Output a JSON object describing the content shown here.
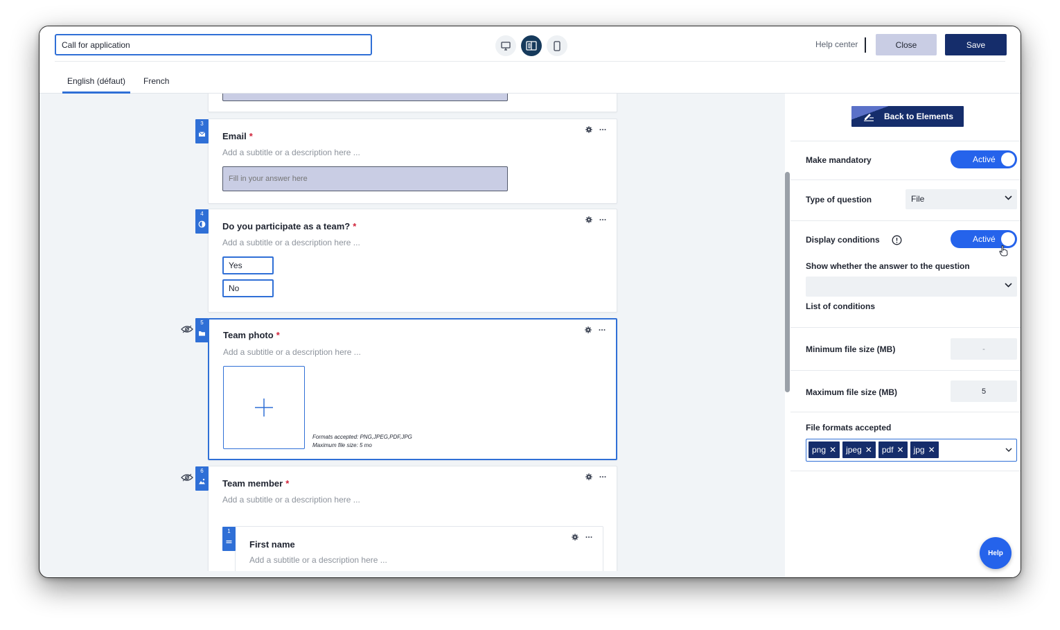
{
  "header": {
    "title_value": "Call for application",
    "help_center": "Help center",
    "close_label": "Close",
    "save_label": "Save",
    "view_modes": [
      "desktop-icon",
      "split-view-icon",
      "mobile-icon"
    ],
    "active_view": "split-view-icon"
  },
  "languages": [
    {
      "label": "English (défaut)",
      "active": true
    },
    {
      "label": "French",
      "active": false
    }
  ],
  "questions": {
    "email": {
      "number": "3",
      "title": "Email",
      "required_mark": "*",
      "subtitle": "Add a subtitle or a description here ...",
      "placeholder": "Fill in your answer here",
      "icon": "envelope-icon"
    },
    "team": {
      "number": "4",
      "title": "Do you participate as a team?",
      "required_mark": "*",
      "subtitle": "Add a subtitle or a description here ...",
      "options": [
        "Yes",
        "No"
      ],
      "icon": "half-circle-icon"
    },
    "photo": {
      "number": "5",
      "title": "Team photo",
      "required_mark": "*",
      "subtitle": "Add a subtitle or a description here ...",
      "formats_line": "Formats accepted: PNG,JPEG,PDF,JPG",
      "size_line": "Maximum file size: 5 mo",
      "icon": "folder-icon"
    },
    "member": {
      "number": "6",
      "title": "Team member",
      "required_mark": "*",
      "subtitle": "Add a subtitle or a description here ...",
      "icon": "image-icon",
      "sub": {
        "number": "1",
        "title": "First name",
        "subtitle": "Add a subtitle or a description here ...",
        "icon": "short-text-icon"
      }
    }
  },
  "panel": {
    "back_label": "Back to Elements",
    "make_mandatory": {
      "label": "Make mandatory",
      "toggle": "Activé"
    },
    "type_of_question": {
      "label": "Type of question",
      "value": "File"
    },
    "display_conditions": {
      "label": "Display conditions",
      "toggle": "Activé",
      "show_label": "Show whether the answer to the question",
      "select_value": "",
      "list_label": "List of conditions"
    },
    "min_size": {
      "label": "Minimum file size (MB)",
      "value": "-"
    },
    "max_size": {
      "label": "Maximum file size (MB)",
      "value": "5"
    },
    "formats": {
      "label": "File formats accepted",
      "tags": [
        "png",
        "jpeg",
        "pdf",
        "jpg"
      ],
      "remove_glyph": "✕"
    }
  },
  "help_fab": "Help",
  "colors": {
    "accent": "#2f6fd6",
    "navy": "#152d6b",
    "toggle": "#2563eb",
    "required": "#d0233a"
  }
}
